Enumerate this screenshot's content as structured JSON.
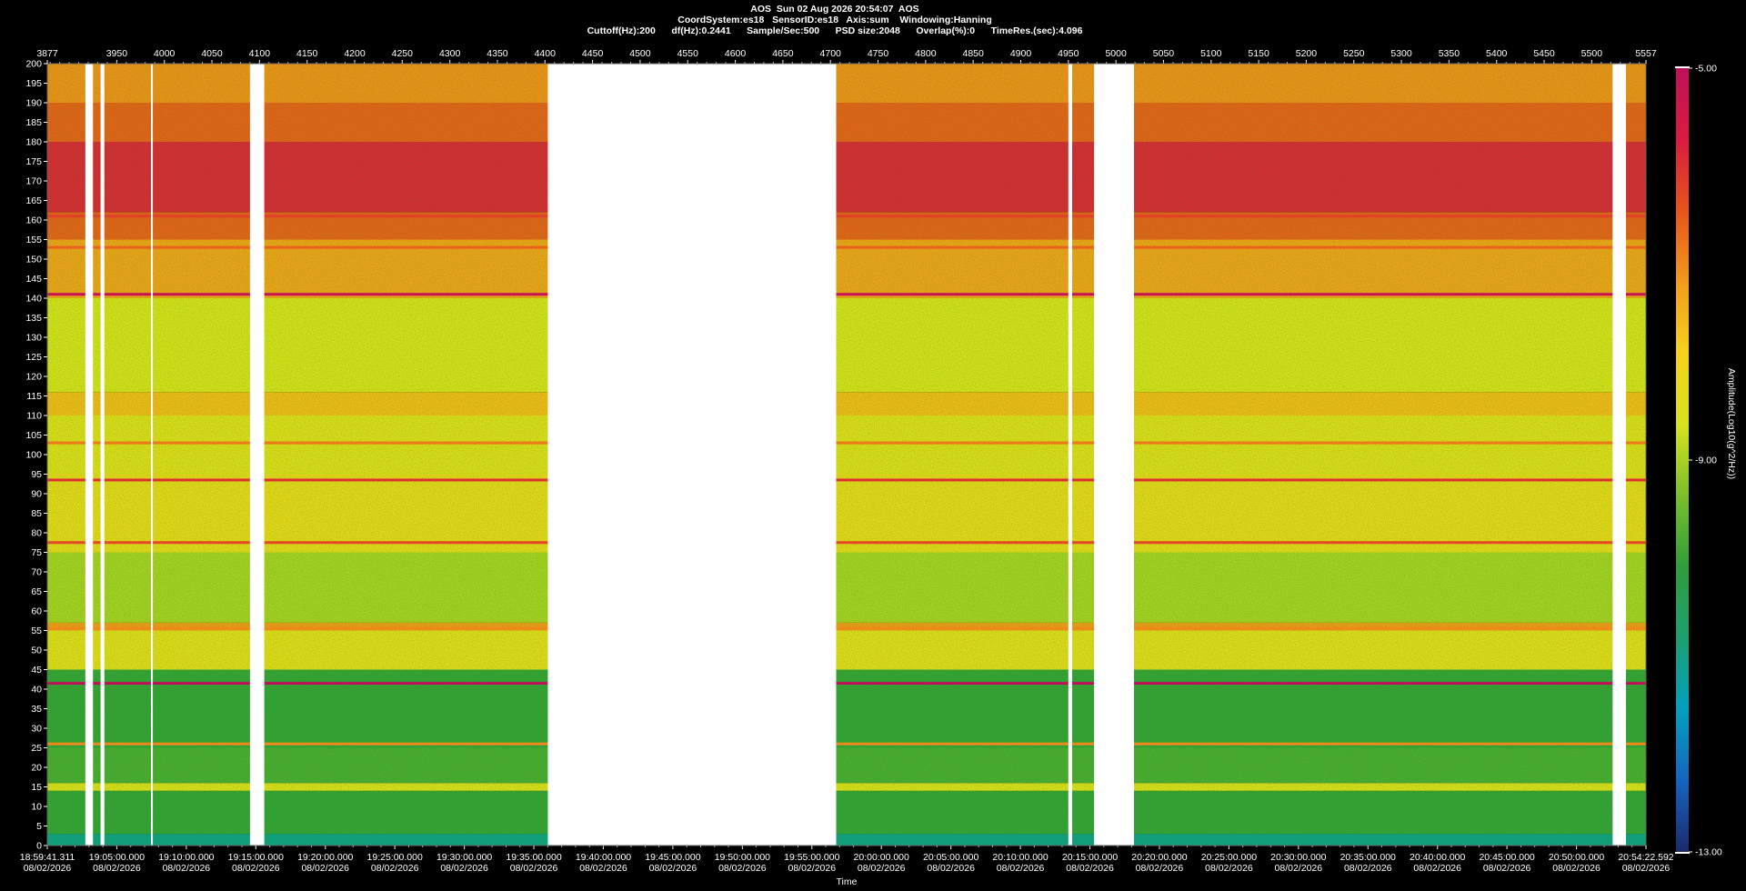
{
  "header": {
    "line1": "AOS  Sun 02 Aug 2026 20:54:07  AOS",
    "line2": "CoordSystem:es18   SensorID:es18   Axis:sum    Windowing:Hanning",
    "line3": "Cuttoff(Hz):200      df(Hz):0.2441      Sample/Sec:500      PSD size:2048      Overlap(%):0      TimeRes.(sec):4.096"
  },
  "colors": {
    "background": "#000000",
    "gap": "#ffffff",
    "colormap": [
      "#1a2a6c",
      "#1565c0",
      "#00a0c0",
      "#1aa070",
      "#2e9e3a",
      "#7bbf2a",
      "#d8e21c",
      "#f6d21a",
      "#f39a1a",
      "#e8541a",
      "#d81b40",
      "#c0105a"
    ]
  },
  "chart_data": {
    "type": "heatmap",
    "title": "AOS  Sun 02 Aug 2026 20:54:07  AOS",
    "xlabel": "Time",
    "ylabel": "",
    "colorbar_label": "Amplitude(Log10(g^2/Hz))",
    "colorbar_ticks": [
      "-5.00",
      "-9.00",
      "-13.00"
    ],
    "colorbar_range": [
      -13,
      -5
    ],
    "ylim": [
      0,
      200
    ],
    "y_ticks": [
      200,
      195,
      190,
      185,
      180,
      175,
      170,
      165,
      160,
      155,
      150,
      145,
      140,
      135,
      130,
      125,
      120,
      115,
      110,
      105,
      100,
      95,
      90,
      85,
      80,
      75,
      70,
      65,
      60,
      55,
      50,
      45,
      40,
      35,
      30,
      25,
      20,
      15,
      10,
      5,
      0
    ],
    "top_axis_range": [
      3877,
      5557
    ],
    "top_axis_ticks": [
      "3877",
      "3950",
      "4000",
      "4050",
      "4100",
      "4150",
      "4200",
      "4250",
      "4300",
      "4350",
      "4400",
      "4450",
      "4500",
      "4550",
      "4600",
      "4650",
      "4700",
      "4750",
      "4800",
      "4850",
      "4900",
      "4950",
      "5000",
      "5050",
      "5100",
      "5150",
      "5200",
      "5250",
      "5300",
      "5350",
      "5400",
      "5450",
      "5500",
      "5557"
    ],
    "time_ticks": [
      {
        "time": "18:59:41.311",
        "date": "08/02/2026"
      },
      {
        "time": "19:05:00.000",
        "date": "08/02/2026"
      },
      {
        "time": "19:10:00.000",
        "date": "08/02/2026"
      },
      {
        "time": "19:15:00.000",
        "date": "08/02/2026"
      },
      {
        "time": "19:20:00.000",
        "date": "08/02/2026"
      },
      {
        "time": "19:25:00.000",
        "date": "08/02/2026"
      },
      {
        "time": "19:30:00.000",
        "date": "08/02/2026"
      },
      {
        "time": "19:35:00.000",
        "date": "08/02/2026"
      },
      {
        "time": "19:40:00.000",
        "date": "08/02/2026"
      },
      {
        "time": "19:45:00.000",
        "date": "08/02/2026"
      },
      {
        "time": "19:50:00.000",
        "date": "08/02/2026"
      },
      {
        "time": "19:55:00.000",
        "date": "08/02/2026"
      },
      {
        "time": "20:00:00.000",
        "date": "08/02/2026"
      },
      {
        "time": "20:05:00.000",
        "date": "08/02/2026"
      },
      {
        "time": "20:10:00.000",
        "date": "08/02/2026"
      },
      {
        "time": "20:15:00.000",
        "date": "08/02/2026"
      },
      {
        "time": "20:20:00.000",
        "date": "08/02/2026"
      },
      {
        "time": "20:25:00.000",
        "date": "08/02/2026"
      },
      {
        "time": "20:30:00.000",
        "date": "08/02/2026"
      },
      {
        "time": "20:35:00.000",
        "date": "08/02/2026"
      },
      {
        "time": "20:40:00.000",
        "date": "08/02/2026"
      },
      {
        "time": "20:45:00.000",
        "date": "08/02/2026"
      },
      {
        "time": "20:50:00.000",
        "date": "08/02/2026"
      },
      {
        "time": "20:54:22.592",
        "date": "08/02/2026"
      }
    ],
    "data_gaps": [
      {
        "from": 3917,
        "to": 3925
      },
      {
        "from": 3933,
        "to": 3937
      },
      {
        "from": 3986,
        "to": 3987
      },
      {
        "from": 4090,
        "to": 4105
      },
      {
        "from": 4403,
        "to": 4706
      },
      {
        "from": 4950,
        "to": 4954
      },
      {
        "from": 4977,
        "to": 5019
      },
      {
        "from": 5522,
        "to": 5536
      }
    ],
    "frequency_bands": [
      {
        "from": 0,
        "to": 3,
        "level": -11.0
      },
      {
        "from": 3,
        "to": 14,
        "level": -10.0
      },
      {
        "from": 14,
        "to": 16,
        "level": -8.5
      },
      {
        "from": 16,
        "to": 25,
        "level": -9.8
      },
      {
        "from": 25,
        "to": 45,
        "level": -10.0
      },
      {
        "from": 45,
        "to": 55,
        "level": -8.3
      },
      {
        "from": 55,
        "to": 57,
        "level": -7.2
      },
      {
        "from": 57,
        "to": 75,
        "level": -9.0
      },
      {
        "from": 75,
        "to": 95,
        "level": -8.2
      },
      {
        "from": 95,
        "to": 110,
        "level": -8.4
      },
      {
        "from": 110,
        "to": 116,
        "level": -7.6
      },
      {
        "from": 116,
        "to": 140,
        "level": -8.6
      },
      {
        "from": 140,
        "to": 155,
        "level": -7.3
      },
      {
        "from": 155,
        "to": 162,
        "level": -6.6
      },
      {
        "from": 162,
        "to": 180,
        "level": -5.9
      },
      {
        "from": 180,
        "to": 190,
        "level": -6.6
      },
      {
        "from": 190,
        "to": 200,
        "level": -7.1
      }
    ],
    "tonal_lines": [
      {
        "freq": 141,
        "level": -5.2
      },
      {
        "freq": 93.5,
        "level": -6.0
      },
      {
        "freq": 77.5,
        "level": -6.3
      },
      {
        "freq": 103,
        "level": -6.8
      },
      {
        "freq": 55.5,
        "level": -7.0
      },
      {
        "freq": 26,
        "level": -7.0
      },
      {
        "freq": 161,
        "level": -6.2
      },
      {
        "freq": 153,
        "level": -6.6
      },
      {
        "freq": 41.5,
        "level": -5.0
      }
    ]
  }
}
